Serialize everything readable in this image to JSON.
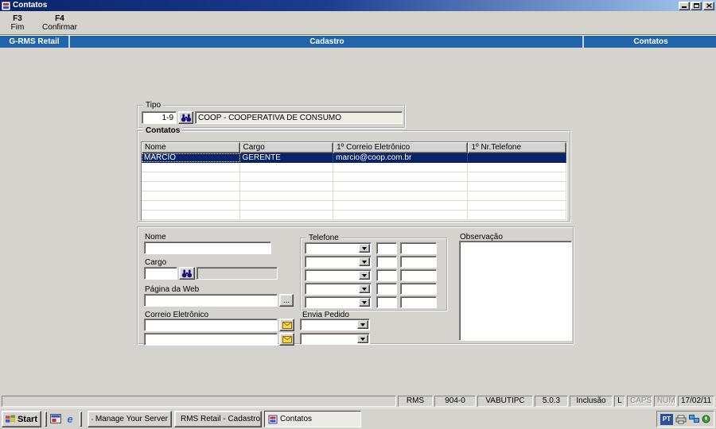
{
  "window": {
    "title": "Contatos"
  },
  "toolbar": {
    "buttons": [
      {
        "key": "F3",
        "label": "Fim"
      },
      {
        "key": "F4",
        "label": "Confirmar"
      }
    ]
  },
  "header": {
    "left": "G-RMS Retail",
    "center": "Cadastro",
    "right": "Contatos"
  },
  "main": {
    "tipo": {
      "label": "Tipo",
      "code": "1-9",
      "description": "COOP - COOPERATIVA DE CONSUMO"
    },
    "contatos": {
      "label": "Contatos",
      "columns": [
        "Nome",
        "Cargo",
        "1º Correio Eletrônico",
        "1º Nr.Telefone"
      ],
      "selected_row": {
        "nome": "MARCIO",
        "cargo": "GERENTE",
        "email": "marcio@coop.com.br",
        "telefone": ""
      },
      "empty_rows": 6
    },
    "form": {
      "nome_label": "Nome",
      "cargo_label": "Cargo",
      "web_label": "Página da Web",
      "browse_label": "...",
      "email_label": "Correio Eletrônico",
      "telefone_label": "Telefone",
      "envia_label": "Envia Pedido",
      "observacao_label": "Observação"
    }
  },
  "statusbar": {
    "app": "RMS",
    "screen": "904-0",
    "program": "VABUTIPC",
    "version": "5.0.3",
    "mode": "Inclusão",
    "lock": "L",
    "caps": "CAPS",
    "num": "NUM",
    "date": "17/02/11"
  },
  "taskbar": {
    "start_label": "Start",
    "quicklaunch_ie_glyph": "e",
    "tasks": [
      "Manage Your Server",
      "RMS Retail - Cadastro / ...",
      "Contatos"
    ],
    "tray": {
      "lang": "PT"
    }
  },
  "colors": {
    "titlebar_left": "#0a246a",
    "titlebar_right": "#a6caf0",
    "header_blue": "#2263ae",
    "selection": "#0a246a",
    "chrome": "#d6d3ce"
  }
}
